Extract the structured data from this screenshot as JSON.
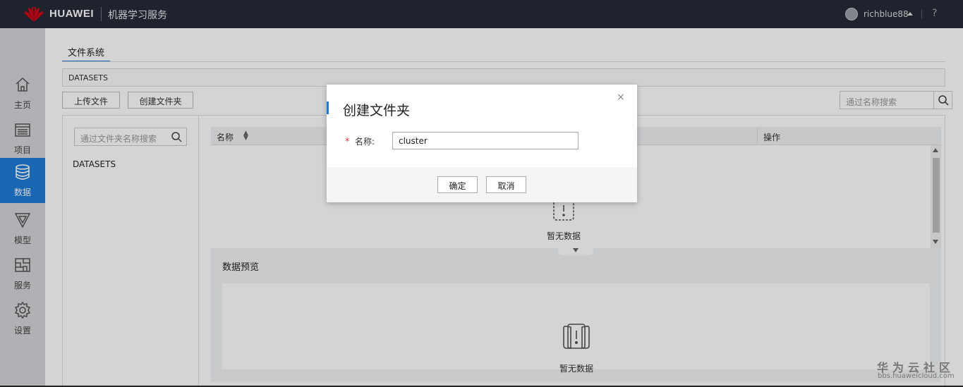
{
  "topbar": {
    "brand": "HUAWEI",
    "service": "机器学习服务",
    "username": "richblue88",
    "help": "?"
  },
  "sidebar": {
    "items": [
      {
        "label": "主页",
        "icon": "home-icon",
        "active": false
      },
      {
        "label": "项目",
        "icon": "list-icon",
        "active": false
      },
      {
        "label": "数据",
        "icon": "database-icon",
        "active": true
      },
      {
        "label": "模型",
        "icon": "model-icon",
        "active": false
      },
      {
        "label": "服务",
        "icon": "service-icon",
        "active": false
      },
      {
        "label": "设置",
        "icon": "gear-icon",
        "active": false
      }
    ]
  },
  "main": {
    "tab": "文件系统",
    "breadcrumb": "DATASETS",
    "upload_button": "上传文件",
    "create_folder_button": "创建文件夹",
    "search_placeholder": "通过名称搜索",
    "folder_search_placeholder": "通过文件夹名称搜索",
    "folders": [
      "DATASETS"
    ],
    "table": {
      "columns": [
        "名称",
        "操作"
      ]
    },
    "empty_text": "暂无数据",
    "preview": {
      "title": "数据预览",
      "empty_text": "暂无数据"
    }
  },
  "dialog": {
    "title": "创建文件夹",
    "close": "×",
    "required_mark": "*",
    "name_label": "名称:",
    "name_value": "cluster",
    "confirm_button": "确定",
    "cancel_button": "取消"
  },
  "watermark": {
    "line1": "华为云社区",
    "line2": "bbs.huaweicloud.com"
  },
  "colors": {
    "topbar": "#262b38",
    "accent": "#1f7bd6",
    "sidebar": "#d3d5d9",
    "logo": "#e60012"
  }
}
